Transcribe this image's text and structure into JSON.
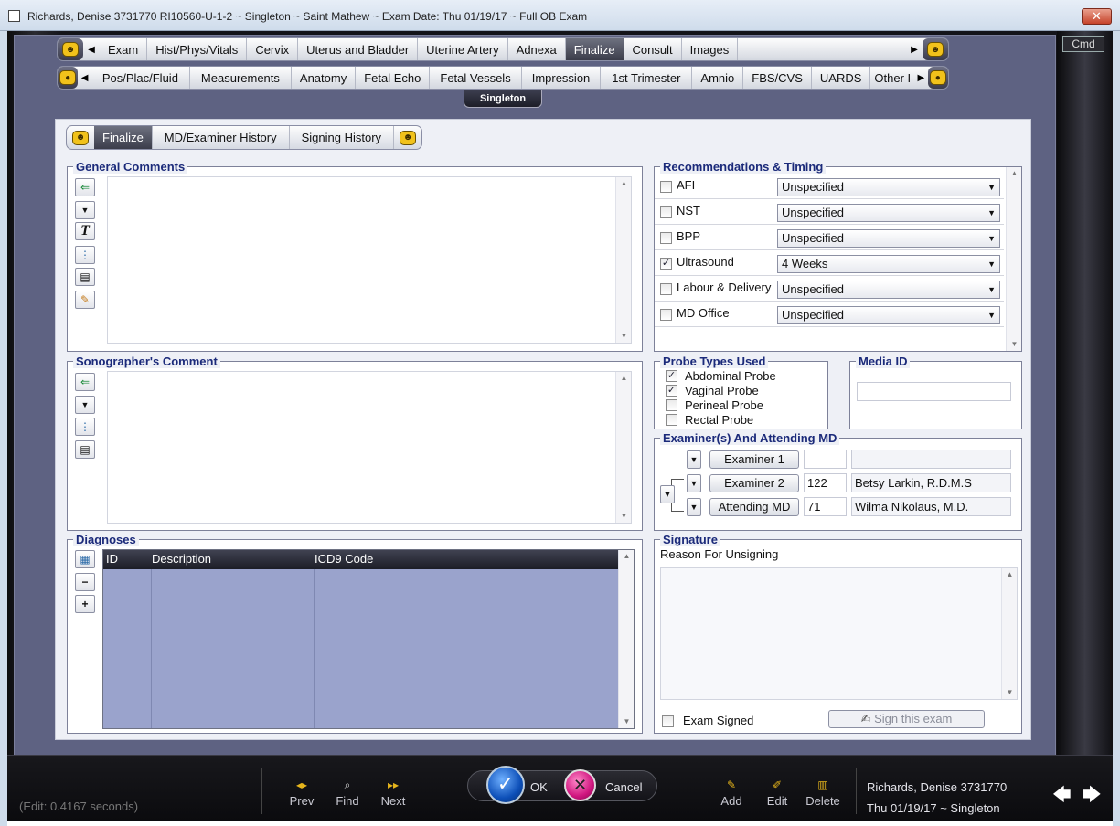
{
  "window": {
    "title": "Richards, Denise  3731770 RI10560-U-1-2 ~ Singleton ~ Saint Mathew ~ Exam Date: Thu 01/19/17 ~ Full OB Exam",
    "close_label": "✕"
  },
  "cmd_label": "Cmd",
  "tabs_row1": [
    "Exam",
    "Hist/Phys/Vitals",
    "Cervix",
    "Uterus and Bladder",
    "Uterine Artery",
    "Adnexa",
    "Finalize",
    "Consult",
    "Images"
  ],
  "tabs_row1_active": "Finalize",
  "tabs_row2": [
    "Pos/Plac/Fluid",
    "Measurements",
    "Anatomy",
    "Fetal Echo",
    "Fetal Vessels",
    "Impression",
    "1st Trimester",
    "Amnio",
    "FBS/CVS",
    "UARDS",
    "Other I"
  ],
  "singleton_tab": "Singleton",
  "subtabs": [
    "Finalize",
    "MD/Examiner History",
    "Signing History"
  ],
  "subtabs_active": "Finalize",
  "general_comments": {
    "title": "General Comments",
    "value": ""
  },
  "sonographer_comment": {
    "title": "Sonographer's Comment",
    "value": ""
  },
  "recommendations": {
    "title": "Recommendations & Timing",
    "rows": [
      {
        "label": "AFI",
        "checked": false,
        "value": "Unspecified"
      },
      {
        "label": "NST",
        "checked": false,
        "value": "Unspecified"
      },
      {
        "label": "BPP",
        "checked": false,
        "value": "Unspecified"
      },
      {
        "label": "Ultrasound",
        "checked": true,
        "value": "4 Weeks"
      },
      {
        "label": "Labour & Delivery",
        "checked": false,
        "value": "Unspecified"
      },
      {
        "label": "MD Office",
        "checked": false,
        "value": "Unspecified"
      }
    ]
  },
  "probe_types": {
    "title": "Probe Types Used",
    "items": [
      {
        "label": "Abdominal Probe",
        "checked": true
      },
      {
        "label": "Vaginal Probe",
        "checked": true
      },
      {
        "label": "Perineal Probe",
        "checked": false
      },
      {
        "label": "Rectal Probe",
        "checked": false
      }
    ]
  },
  "media_id": {
    "title": "Media ID",
    "value": ""
  },
  "examiners": {
    "title": "Examiner(s) And Attending MD",
    "rows": [
      {
        "button": "Examiner 1",
        "id": "",
        "name": ""
      },
      {
        "button": "Examiner 2",
        "id": "122",
        "name": "Betsy Larkin, R.D.M.S"
      },
      {
        "button": "Attending MD",
        "id": "71",
        "name": "Wilma Nikolaus, M.D."
      }
    ]
  },
  "diagnoses": {
    "title": "Diagnoses",
    "columns": [
      "ID",
      "Description",
      "ICD9 Code"
    ],
    "rows": []
  },
  "signature": {
    "title": "Signature",
    "reason_label": "Reason For Unsigning",
    "reason_value": "",
    "exam_signed_label": "Exam Signed",
    "exam_signed": false,
    "sign_button": "Sign this exam"
  },
  "bottom": {
    "edit_status": "(Edit: 0.4167 seconds)",
    "prev": "Prev",
    "find": "Find",
    "next": "Next",
    "ok": "OK",
    "cancel": "Cancel",
    "add": "Add",
    "edit": "Edit",
    "delete": "Delete",
    "patient_line": "Richards, Denise  3731770",
    "date_line": "Thu 01/19/17 ~ Singleton"
  },
  "colors": {
    "accent_blue": "#1b2a7a",
    "panel_bg": "#5e6282",
    "grid_bg": "#9aa3cc",
    "tab_active": "#3b3d4a"
  }
}
